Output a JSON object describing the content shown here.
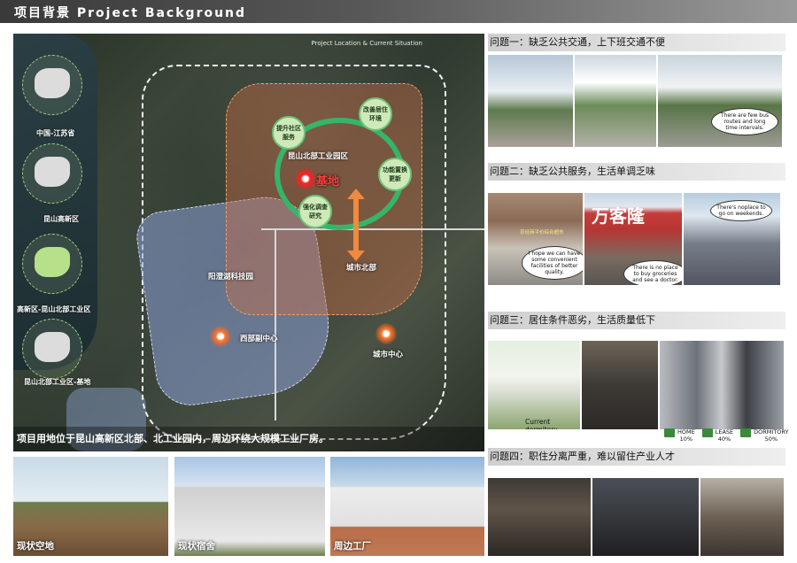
{
  "header": {
    "title": "项目背景 Project Background"
  },
  "map": {
    "caption": "Project Location & Current Situation",
    "labels": {
      "north_zone": "昆山北部工业园区",
      "site": "基地",
      "tech_park": "阳澄湖科技园",
      "north_city": "城市北部",
      "west_center": "西部副中心",
      "city_center": "城市中心"
    },
    "bubbles": [
      "提升社区服务",
      "改善居住环境",
      "功能置换更新",
      "强化调查研究"
    ],
    "insets": [
      "中国-江苏省",
      "昆山高新区",
      "高新区-昆山北部工业区",
      "昆山北部工业区-基地"
    ],
    "bottom_text": "项目用地位于昆山高新区北部、北工业园内，周边环绕大规模工业厂房。"
  },
  "photos": [
    {
      "label": "现状空地"
    },
    {
      "label": "现状宿舍"
    },
    {
      "label": "周边工厂"
    }
  ],
  "problems": [
    {
      "title": "问题一：缺乏公共交通，上下班交通不便",
      "speech": [
        "There are few bus routes and long time intervals."
      ]
    },
    {
      "title": "问题二：缺乏公共服务，生活单调乏味",
      "speech": [
        "I hope we can have some convenient facilities of better quality.",
        "There's noplace to go on weekends.",
        "There is no place to buy groceries and see a doctor."
      ],
      "signs": [
        "万客隆",
        "农经商平价综合超市"
      ]
    },
    {
      "title": "问题三：居住条件恶劣，生活质量低下",
      "caption": "Current dormitory",
      "legend": [
        {
          "label": "HOME",
          "value": "10%"
        },
        {
          "label": "LEASE",
          "value": "40%"
        },
        {
          "label": "DORMITORY",
          "value": "50%"
        }
      ]
    },
    {
      "title": "问题四：职住分离严重，难以留住产业人才"
    }
  ]
}
